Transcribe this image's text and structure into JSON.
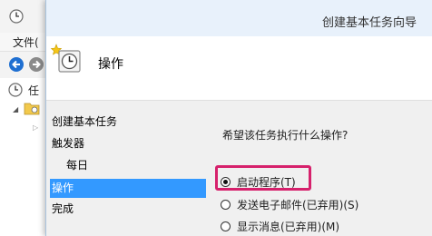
{
  "background_window": {
    "menu": {
      "file": "文件("
    },
    "tree": {
      "root_label": "任"
    }
  },
  "dialog": {
    "title": "创建基本任务向导",
    "header_title": "操作",
    "steps": [
      {
        "label": "创建基本任务",
        "active": false
      },
      {
        "label": "触发器",
        "active": false
      },
      {
        "label": "每日",
        "active": false
      },
      {
        "label": "操作",
        "active": true
      },
      {
        "label": "完成",
        "active": false
      }
    ],
    "question": "希望该任务执行什么操作?",
    "options": [
      {
        "label": "启动程序(T)",
        "checked": true
      },
      {
        "label": "发送电子邮件(已弃用)(S)",
        "checked": false
      },
      {
        "label": "显示消息(已弃用)(M)",
        "checked": false
      }
    ]
  },
  "colors": {
    "selection": "#3399ff",
    "highlight_box": "#d6216c",
    "nav_arrow": "#1f6fd1"
  },
  "icons": [
    "clock-icon",
    "back-arrow-icon",
    "forward-arrow-icon",
    "folder-icon",
    "wizard-clock-icon"
  ]
}
